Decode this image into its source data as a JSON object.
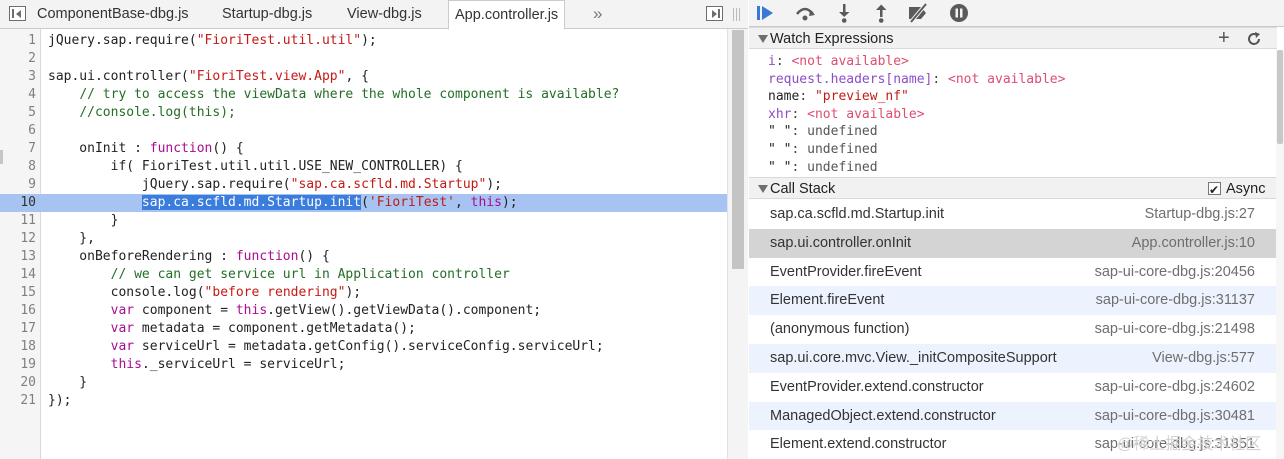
{
  "tabs": [
    {
      "label": "ComponentBase-dbg.js"
    },
    {
      "label": "Startup-dbg.js"
    },
    {
      "label": "View-dbg.js"
    },
    {
      "label": "App.controller.js"
    }
  ],
  "tab_overflow": "»",
  "code_lines": [
    {
      "n": "1",
      "t": "jQuery.sap.require(\"FioriTest.util.util\");"
    },
    {
      "n": "2",
      "t": ""
    },
    {
      "n": "3",
      "t": "sap.ui.controller(\"FioriTest.view.App\", {"
    },
    {
      "n": "4",
      "t": "    // try to access the viewData where the whole component is available?"
    },
    {
      "n": "5",
      "t": "    //console.log(this);"
    },
    {
      "n": "6",
      "t": ""
    },
    {
      "n": "7",
      "t": "    onInit : function() {"
    },
    {
      "n": "8",
      "t": "        if( FioriTest.util.util.USE_NEW_CONTROLLER) {"
    },
    {
      "n": "9",
      "t": "            jQuery.sap.require(\"sap.ca.scfld.md.Startup\");"
    },
    {
      "n": "10",
      "t": "            sap.ca.scfld.md.Startup.init('FioriTest', this);"
    },
    {
      "n": "11",
      "t": "        }"
    },
    {
      "n": "12",
      "t": "    },"
    },
    {
      "n": "13",
      "t": "    onBeforeRendering : function() {"
    },
    {
      "n": "14",
      "t": "        // we can get service url in Application controller"
    },
    {
      "n": "15",
      "t": "        console.log(\"before rendering\");"
    },
    {
      "n": "16",
      "t": "        var component = this.getView().getViewData().component;"
    },
    {
      "n": "17",
      "t": "        var metadata = component.getMetadata();"
    },
    {
      "n": "18",
      "t": "        var serviceUrl = metadata.getConfig().serviceConfig.serviceUrl;"
    },
    {
      "n": "19",
      "t": "        this._serviceUrl = serviceUrl;"
    },
    {
      "n": "20",
      "t": "    }"
    },
    {
      "n": "21",
      "t": "});"
    }
  ],
  "exec_line": {
    "number": "10",
    "indent": "            ",
    "selected": "sap.ca.scfld.md.Startup.init",
    "paren_open": "(",
    "arg_string": "'FioriTest'",
    "comma": ", ",
    "this_kw": "this",
    "tail": ");"
  },
  "toolbar_icons": [
    "resume-icon",
    "step-over-icon",
    "step-into-icon",
    "step-out-icon",
    "deactivate-breakpoints-icon",
    "pause-on-exceptions-icon"
  ],
  "watch": {
    "title": "Watch Expressions",
    "add_glyph": "+",
    "items": [
      {
        "name": "i",
        "value": "<not available>",
        "kind": "na"
      },
      {
        "name": "request.headers[name]",
        "value": "<not available>",
        "kind": "na"
      },
      {
        "name": "name",
        "value": "\"preview_nf\"",
        "kind": "str"
      },
      {
        "name": "xhr",
        "value": "<not available>",
        "kind": "na"
      },
      {
        "name": "\" \"",
        "value": "undefined",
        "kind": "undef"
      },
      {
        "name": "\" \"",
        "value": "undefined",
        "kind": "undef"
      },
      {
        "name": "\" \"",
        "value": "undefined",
        "kind": "undef"
      }
    ]
  },
  "callstack": {
    "title": "Call Stack",
    "async_label": "Async",
    "async_checked": true,
    "frames": [
      {
        "fn": "sap.ca.scfld.md.Startup.init",
        "loc": "Startup-dbg.js:27"
      },
      {
        "fn": "sap.ui.controller.onInit",
        "loc": "App.controller.js:10"
      },
      {
        "fn": "EventProvider.fireEvent",
        "loc": "sap-ui-core-dbg.js:20456"
      },
      {
        "fn": "Element.fireEvent",
        "loc": "sap-ui-core-dbg.js:31137"
      },
      {
        "fn": "(anonymous function)",
        "loc": "sap-ui-core-dbg.js:21498"
      },
      {
        "fn": "sap.ui.core.mvc.View._initCompositeSupport",
        "loc": "View-dbg.js:577"
      },
      {
        "fn": "EventProvider.extend.constructor",
        "loc": "sap-ui-core-dbg.js:24602"
      },
      {
        "fn": "ManagedObject.extend.constructor",
        "loc": "sap-ui-core-dbg.js:30481"
      },
      {
        "fn": "Element.extend.constructor",
        "loc": "sap-ui-core-dbg.js:31851"
      }
    ],
    "selected_index": 1
  },
  "watermark": "@稀土掘金技术社区",
  "colors": {
    "exec_line": "#a6c3f2",
    "selection": "#3b7ddd",
    "string": "#c41a16",
    "keyword": "#aa0d91",
    "comment": "#236e25",
    "not_available": "#dd4d73",
    "accent_resume": "#3a78d8"
  }
}
